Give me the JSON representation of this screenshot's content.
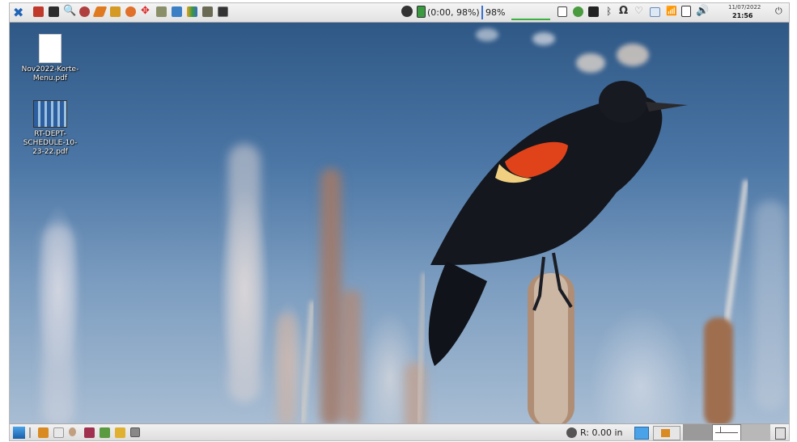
{
  "top_panel": {
    "battery_status": "(0:00, 98%)",
    "battery_meter": "98%",
    "clock_date": "11/07/2022",
    "clock_time": "21:56"
  },
  "desktop": {
    "icons": [
      {
        "label": "Nov2022-Korte-Menu.pdf"
      },
      {
        "label": "RT-DEPT-SCHEDULE-10-23-22.pdf"
      }
    ]
  },
  "bottom_panel": {
    "network_rate": "R: 0.00 in"
  },
  "colors": {
    "panel_bg": "#e8e8e8",
    "sky_top": "#2f5886",
    "sky_bottom": "#a8bdd3",
    "accent_blue": "#3a78c0"
  }
}
